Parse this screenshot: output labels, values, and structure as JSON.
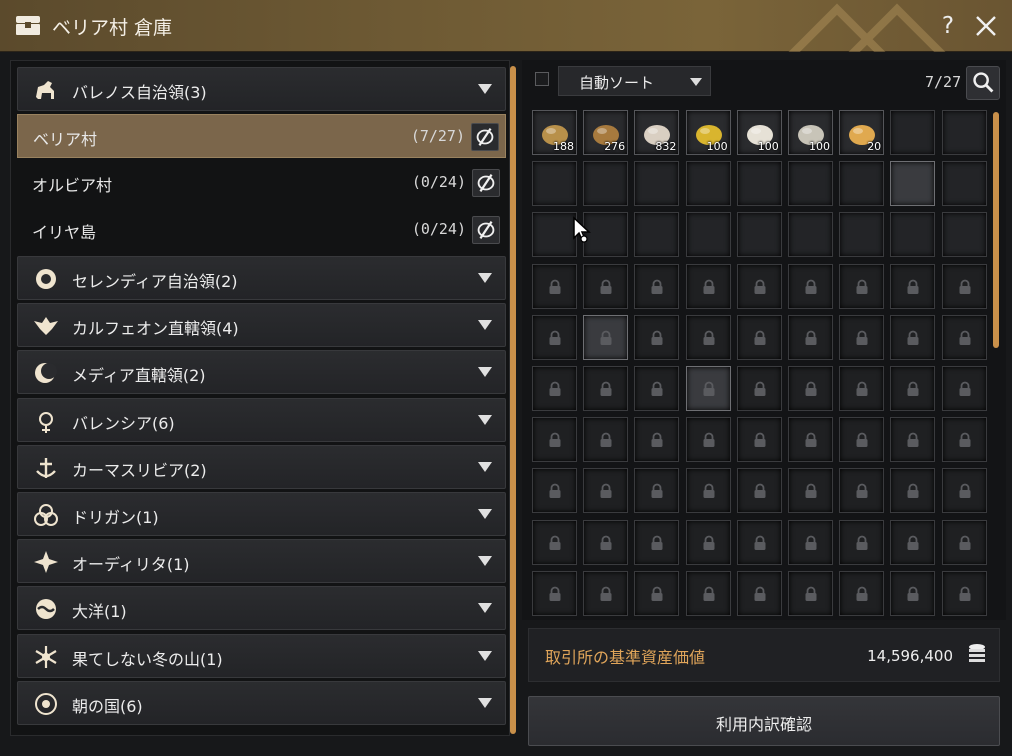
{
  "window": {
    "title": "ベリア村 倉庫",
    "help_label": "?",
    "title_icon": "chest-icon",
    "close_icon": "close-icon"
  },
  "regions_top": {
    "label": "バレノス自治領(3)",
    "icon": "horse-icon"
  },
  "villages": [
    {
      "name": "ベリア村",
      "count": "(7/27)",
      "selected": true
    },
    {
      "name": "オルビア村",
      "count": "(0/24)",
      "selected": false
    },
    {
      "name": "イリヤ島",
      "count": "(0/24)",
      "selected": false
    }
  ],
  "regions": [
    {
      "label": "セレンディア自治領(2)",
      "icon": "lion-icon"
    },
    {
      "label": "カルフェオン直轄領(4)",
      "icon": "eagle-icon"
    },
    {
      "label": "メディア直轄領(2)",
      "icon": "crescent-moon-icon"
    },
    {
      "label": "バレンシア(6)",
      "icon": "sun-emblem-icon"
    },
    {
      "label": "カーマスリビア(2)",
      "icon": "anchor-emblem-icon"
    },
    {
      "label": "ドリガン(1)",
      "icon": "triquetra-icon"
    },
    {
      "label": "オーディリタ(1)",
      "icon": "star-emblem-icon"
    },
    {
      "label": "大洋(1)",
      "icon": "ocean-icon"
    },
    {
      "label": "果てしない冬の山(1)",
      "icon": "snowflake-icon"
    },
    {
      "label": "朝の国(6)",
      "icon": "morning-emblem-icon"
    }
  ],
  "inventory": {
    "sort_label": "自動ソート",
    "slot_count": "7/27",
    "items": [
      {
        "name": "potato-item",
        "qty": "188",
        "color": "#b8904a"
      },
      {
        "name": "nuts-item",
        "qty": "276",
        "color": "#a77a3e"
      },
      {
        "name": "chicken-meat-item",
        "qty": "832",
        "color": "#d9cfc2"
      },
      {
        "name": "corn-item",
        "qty": "100",
        "color": "#d9b52e"
      },
      {
        "name": "flour-item",
        "qty": "100",
        "color": "#e6e1d6"
      },
      {
        "name": "grain-item",
        "qty": "100",
        "color": "#c8c4b8"
      },
      {
        "name": "cheese-item",
        "qty": "20",
        "color": "#e0a94f"
      }
    ],
    "unlocked_slots": 27,
    "highlighted_slots": [
      16,
      37,
      48
    ]
  },
  "asset": {
    "label": "取引所の基準資産価値",
    "value": "14,596,400",
    "icon": "coin-stack-icon"
  },
  "usage_button": "利用内訳確認",
  "colors": {
    "accent": "#c9904a",
    "selected_row": "#7b664b",
    "asset_label": "#e0a55a"
  }
}
